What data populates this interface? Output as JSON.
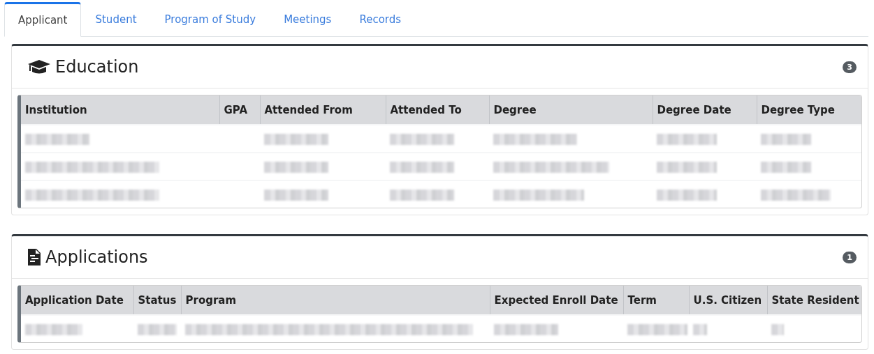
{
  "tabs": [
    {
      "label": "Applicant",
      "selected": true
    },
    {
      "label": "Student",
      "selected": false
    },
    {
      "label": "Program of Study",
      "selected": false
    },
    {
      "label": "Meetings",
      "selected": false
    },
    {
      "label": "Records",
      "selected": false
    }
  ],
  "sections": [
    {
      "kind": "education",
      "title": "Education",
      "count": "3",
      "columns": [
        "Institution",
        "GPA",
        "Attended From",
        "Attended To",
        "Degree",
        "Degree Date",
        "Degree Type"
      ],
      "rows": [
        {
          "cells": [
            {
              "kind": "blurred"
            },
            {
              "kind": "empty"
            },
            {
              "kind": "blurred"
            },
            {
              "kind": "blurred"
            },
            {
              "kind": "blurred"
            },
            {
              "kind": "blurred"
            },
            {
              "kind": "blurred"
            }
          ]
        },
        {
          "cells": [
            {
              "kind": "blurred"
            },
            {
              "kind": "empty"
            },
            {
              "kind": "blurred"
            },
            {
              "kind": "blurred"
            },
            {
              "kind": "blurred"
            },
            {
              "kind": "blurred"
            },
            {
              "kind": "blurred"
            }
          ]
        },
        {
          "cells": [
            {
              "kind": "blurred"
            },
            {
              "kind": "empty"
            },
            {
              "kind": "blurred"
            },
            {
              "kind": "blurred"
            },
            {
              "kind": "blurred"
            },
            {
              "kind": "blurred"
            },
            {
              "kind": "blurred"
            }
          ]
        }
      ]
    },
    {
      "kind": "applications",
      "title": "Applications",
      "count": "1",
      "columns": [
        "Application Date",
        "Status",
        "Program",
        "Expected Enroll Date",
        "Term",
        "U.S. Citizen",
        "State Resident"
      ],
      "rows": [
        {
          "cells": [
            {
              "kind": "blurred"
            },
            {
              "kind": "blurred"
            },
            {
              "kind": "blurred"
            },
            {
              "kind": "blurred"
            },
            {
              "kind": "blurred"
            },
            {
              "kind": "blurred"
            },
            {
              "kind": "blurred"
            }
          ]
        }
      ]
    }
  ]
}
